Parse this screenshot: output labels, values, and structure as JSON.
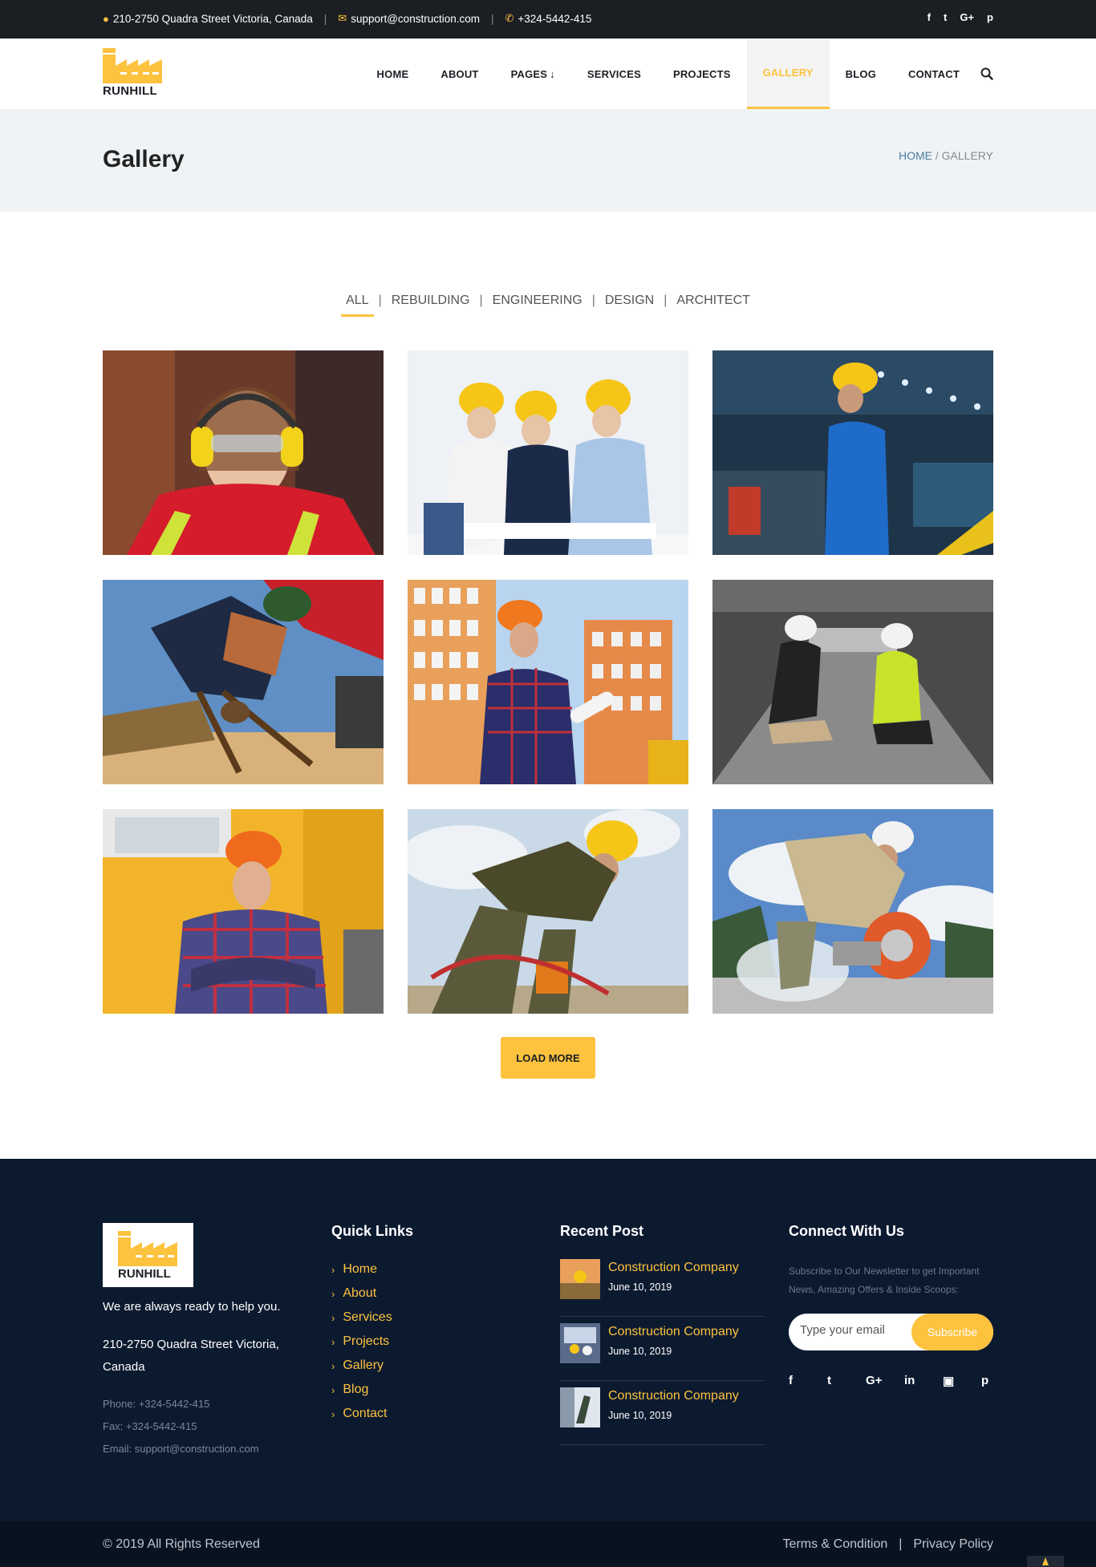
{
  "topbar": {
    "address": "210-2750 Quadra Street Victoria, Canada",
    "email": "support@construction.com",
    "phone": "+324-5442-415",
    "social_icons": [
      "facebook-icon",
      "twitter-icon",
      "google-plus-icon",
      "pinterest-icon"
    ],
    "social_glyphs": [
      "f",
      "t",
      "G+",
      "p"
    ]
  },
  "brand": {
    "name": "RUNHILL",
    "accent": "#fdc23e",
    "dark": "#1b1e23"
  },
  "nav": {
    "items": [
      "HOME",
      "ABOUT",
      "PAGES",
      "SERVICES",
      "PROJECTS",
      "GALLERY",
      "BLOG",
      "CONTACT"
    ],
    "active": "GALLERY"
  },
  "page": {
    "title": "Gallery",
    "breadcrumb_home": "HOME",
    "breadcrumb_sep": "/",
    "breadcrumb_current": "GALLERY"
  },
  "filters": {
    "items": [
      "ALL",
      "REBUILDING",
      "ENGINEERING",
      "DESIGN",
      "ARCHITECT"
    ],
    "active": "ALL"
  },
  "gallery": {
    "tiles": [
      "woman-with-ear-protection",
      "three-engineers-with-blueprints",
      "worker-in-factory",
      "worker-with-chain",
      "engineer-on-phone",
      "workers-inspecting-floor",
      "worker-arms-crossed",
      "worker-with-drill",
      "worker-with-saw"
    ]
  },
  "load_more": "LOAD MORE",
  "footer": {
    "tagline": "We are always ready to help you.",
    "address": "210-2750 Quadra Street Victoria, Canada",
    "phone": "Phone: +324-5442-415",
    "fax": "Fax: +324-5442-415",
    "email": "Email: support@construction.com",
    "quick_links_title": "Quick Links",
    "quick_links": [
      "Home",
      "About",
      "Services",
      "Projects",
      "Gallery",
      "Blog",
      "Contact"
    ],
    "recent_title": "Recent Post",
    "posts": [
      {
        "title": "Construction Company",
        "date": "June 10, 2019"
      },
      {
        "title": "Construction Company",
        "date": "June 10, 2019"
      },
      {
        "title": "Construction Company",
        "date": "June 10, 2019"
      }
    ],
    "connect_title": "Connect With Us",
    "connect_desc": "Subscribe to Our Newsletter to get Important News, Amazing Offers & Inside Scoops:",
    "email_placeholder": "Type your email",
    "subscribe_label": "Subscribe",
    "social_icons": [
      "facebook-icon",
      "twitter-icon",
      "google-plus-icon",
      "linkedin-icon",
      "youtube-icon",
      "pinterest-icon"
    ],
    "social_glyphs": [
      "f",
      "t",
      "G+",
      "in",
      "▣",
      "p"
    ]
  },
  "bottom": {
    "copyright": "© 2019 All Rights Reserved",
    "terms": "Terms & Condition",
    "sep": "|",
    "privacy": "Privacy Policy"
  }
}
